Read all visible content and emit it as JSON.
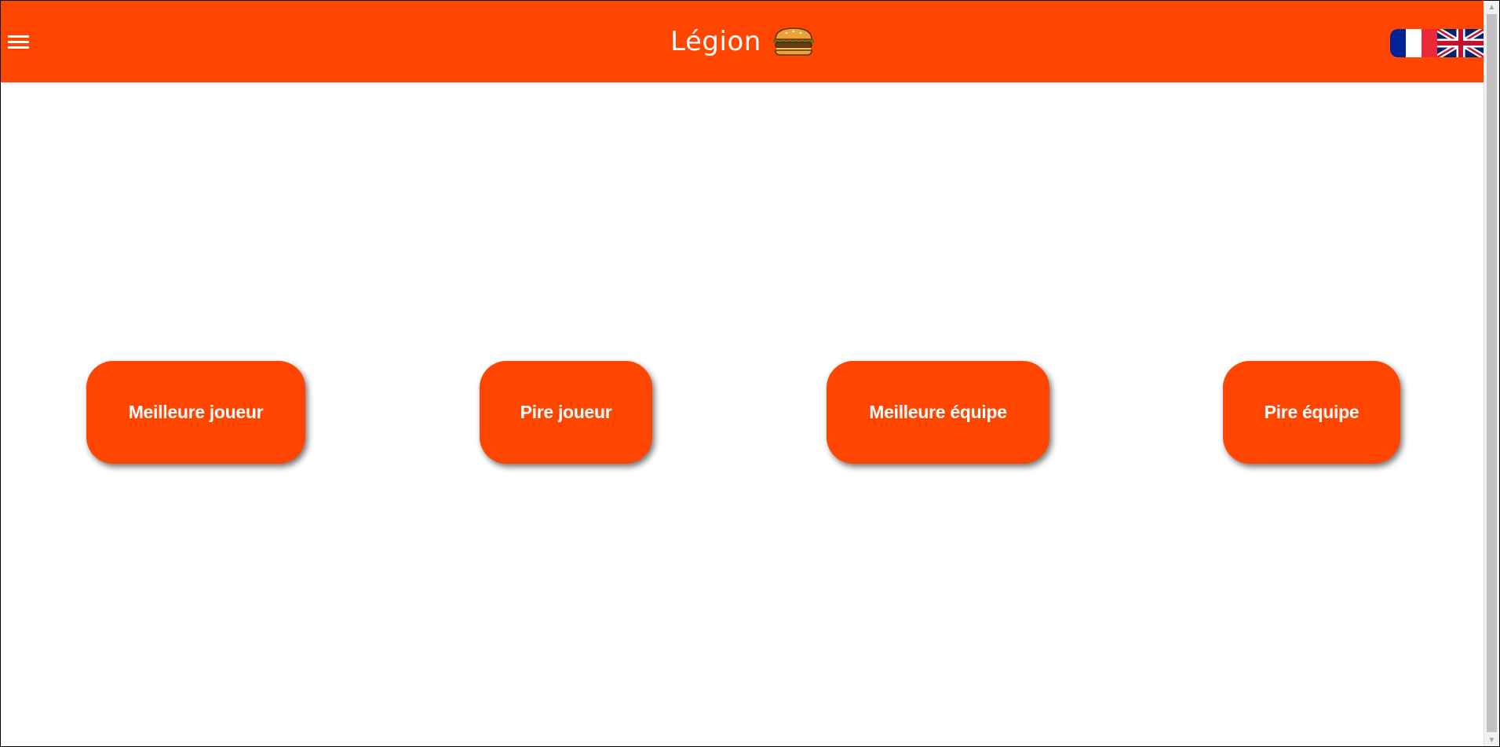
{
  "header": {
    "title": "Légion",
    "menu_icon": "hamburger-menu-icon",
    "logo_icon": "burger-icon",
    "background_color": "#ff4500"
  },
  "languages": [
    {
      "code": "fr",
      "icon": "french-flag-icon"
    },
    {
      "code": "en",
      "icon": "uk-flag-icon"
    }
  ],
  "buttons": {
    "best_player": "Meilleure joueur",
    "worst_player": "Pire joueur",
    "best_team": "Meilleure équipe",
    "worst_team": "Pire équipe"
  },
  "colors": {
    "accent": "#ff4500",
    "text_on_accent": "#ffffff"
  }
}
